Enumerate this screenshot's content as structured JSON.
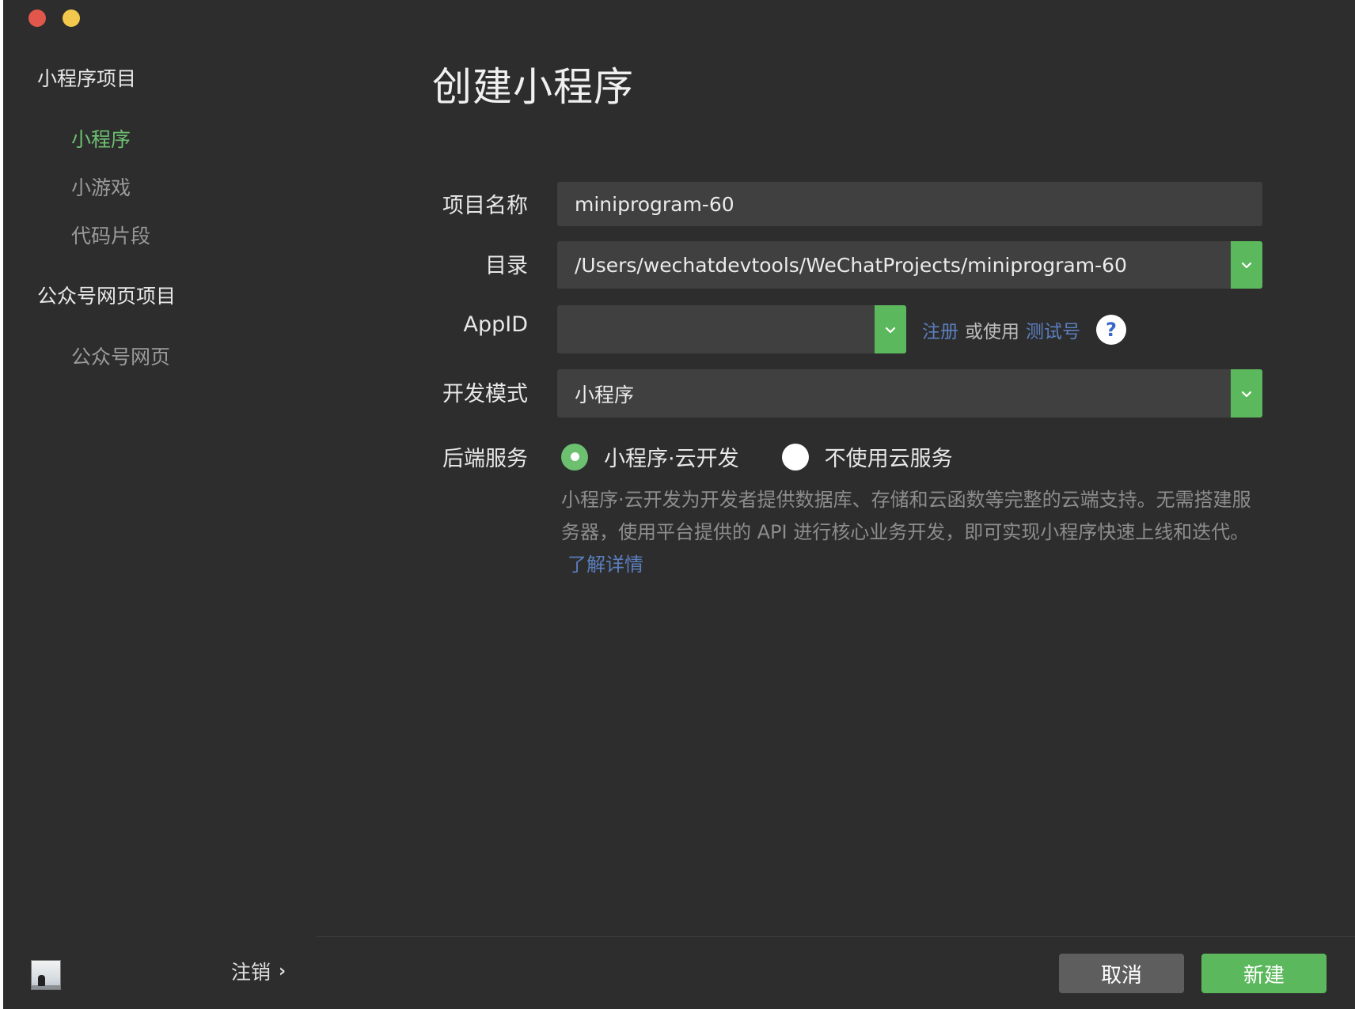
{
  "window": {
    "title": "创建小程序"
  },
  "sidebar": {
    "groups": [
      {
        "label": "小程序项目",
        "items": [
          {
            "label": "小程序",
            "active": true
          },
          {
            "label": "小游戏",
            "active": false
          },
          {
            "label": "代码片段",
            "active": false
          }
        ]
      },
      {
        "label": "公众号网页项目",
        "items": [
          {
            "label": "公众号网页",
            "active": false
          }
        ]
      }
    ],
    "footer": {
      "logout_label": "注销",
      "logout_chevron": "›"
    }
  },
  "form": {
    "project_name": {
      "label": "项目名称",
      "value": "miniprogram-60"
    },
    "directory": {
      "label": "目录",
      "value": "/Users/wechatdevtools/WeChatProjects/miniprogram-60"
    },
    "appid": {
      "label": "AppID",
      "value": "",
      "register_link": "注册",
      "or_use_text": "或使用",
      "test_account_link": "测试号",
      "help_glyph": "?"
    },
    "dev_mode": {
      "label": "开发模式",
      "value": "小程序"
    },
    "backend": {
      "label": "后端服务",
      "options": [
        {
          "label": "小程序·云开发",
          "selected": true
        },
        {
          "label": "不使用云服务",
          "selected": false
        }
      ],
      "description": "小程序·云开发为开发者提供数据库、存储和云函数等完整的云端支持。无需搭建服务器，使用平台提供的 API 进行核心业务开发，即可实现小程序快速上线和迭代。",
      "learn_more_link": "了解详情"
    }
  },
  "actions": {
    "cancel_label": "取消",
    "create_label": "新建"
  },
  "colors": {
    "accent_green": "#5cb85c",
    "link_blue": "#5b7fbf",
    "background": "#2d2d2d"
  },
  "icons": {
    "select_chevron": "chevron-down-icon",
    "help": "question-icon"
  }
}
